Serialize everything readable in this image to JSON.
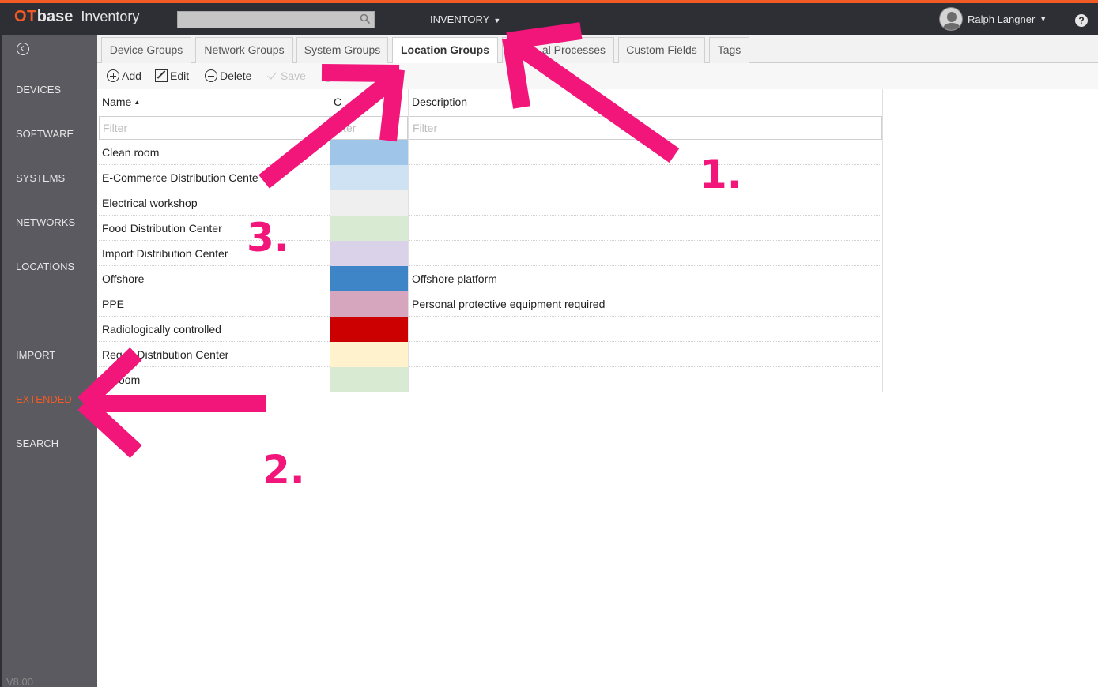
{
  "app": {
    "logo_ot": "OT",
    "logo_base": "base",
    "app_name": "Inventory",
    "module_menu": "INVENTORY",
    "user_name": "Ralph Langner",
    "help": "?",
    "version": "V8.00"
  },
  "sidebar": {
    "items": [
      {
        "label": "DEVICES"
      },
      {
        "label": "SOFTWARE"
      },
      {
        "label": "SYSTEMS"
      },
      {
        "label": "NETWORKS"
      },
      {
        "label": "LOCATIONS"
      },
      {
        "label": "IMPORT"
      },
      {
        "label": "EXTENDED"
      },
      {
        "label": "SEARCH"
      }
    ],
    "active_color": "#f15a24"
  },
  "tabs": [
    {
      "label": "Device Groups"
    },
    {
      "label": "Network Groups"
    },
    {
      "label": "System Groups"
    },
    {
      "label": "Location Groups"
    },
    {
      "label": "al Processes"
    },
    {
      "label": "Custom Fields"
    },
    {
      "label": "Tags"
    }
  ],
  "toolbar": {
    "add": "Add",
    "edit": "Edit",
    "delete": "Delete",
    "save": "Save"
  },
  "grid": {
    "columns": {
      "name": "Name",
      "color": "C",
      "description": "Description"
    },
    "filter_placeholder": "Filter",
    "color_filter_partial": "lter",
    "rows": [
      {
        "name": "Clean room",
        "color": "#9fc5e8",
        "description": ""
      },
      {
        "name": "E-Commerce Distribution Cente",
        "color": "#cfe2f3",
        "description": ""
      },
      {
        "name": "Electrical workshop",
        "color": "#efefef",
        "description": ""
      },
      {
        "name": "Food Distribution Center",
        "color": "#d9ead3",
        "description": ""
      },
      {
        "name": "Import Distribution Center",
        "color": "#d9d2e9",
        "description": ""
      },
      {
        "name": "Offshore",
        "color": "#3d85c6",
        "description": "Offshore platform"
      },
      {
        "name": "PPE",
        "color": "#d5a6bd",
        "description": "Personal protective equipment required"
      },
      {
        "name": "Radiologically controlled",
        "color": "#cc0000",
        "description": ""
      },
      {
        "name": "Reg   al Distribution Center",
        "color": "#fff2cc",
        "description": ""
      },
      {
        "name": "   er room",
        "color": "#d9ead3",
        "description": ""
      }
    ]
  },
  "annotations": {
    "labels": [
      "1.",
      "2.",
      "3."
    ],
    "color": "#f2157a"
  }
}
